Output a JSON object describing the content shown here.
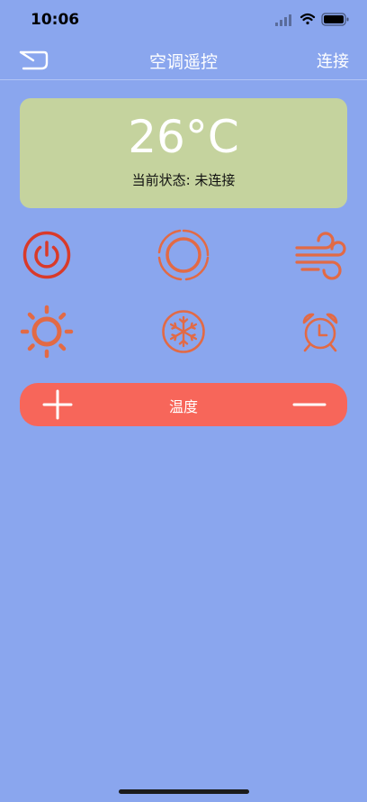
{
  "status_bar": {
    "time": "10:06"
  },
  "nav": {
    "title": "空调遥控",
    "connect_label": "连接"
  },
  "display": {
    "temperature": "26°C",
    "status_text": "当前状态: 未连接"
  },
  "controls": {
    "temperature_label": "温度",
    "buttons": [
      "power-icon",
      "mode-ring-icon",
      "wind-icon",
      "sun-icon",
      "snowflake-icon",
      "alarm-clock-icon"
    ]
  },
  "colors": {
    "background": "#8aa6ee",
    "card": "#c5d39e",
    "accent": "#f7665a",
    "icon": "#e26a45",
    "power": "#d93a2a"
  }
}
